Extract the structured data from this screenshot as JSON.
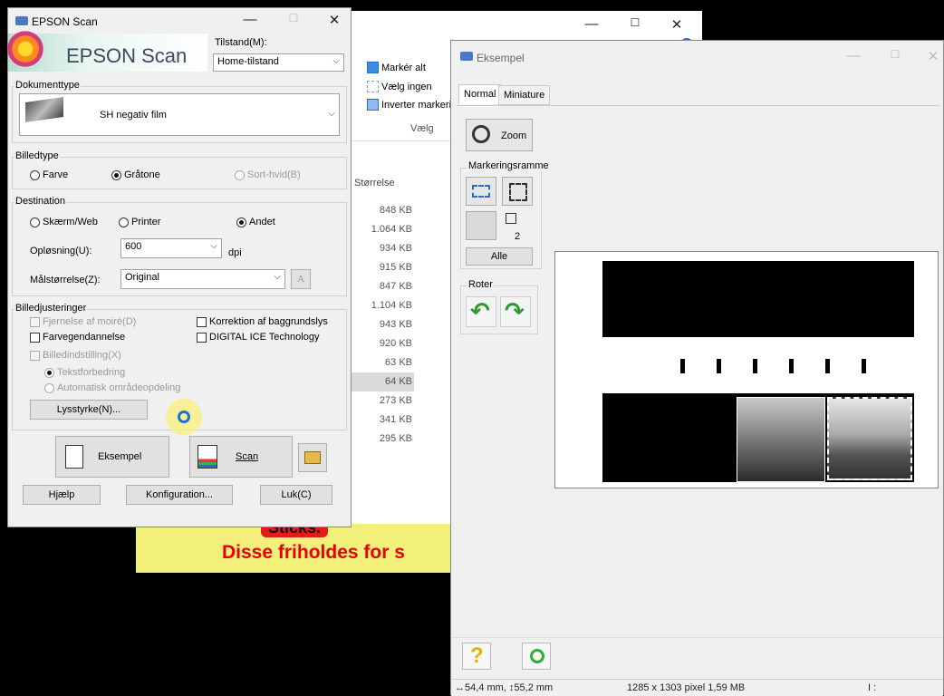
{
  "epson": {
    "title": "EPSON Scan",
    "logo_text": "EPSON Scan",
    "mode_label": "Tilstand(M):",
    "mode_value": "Home-tilstand",
    "doctype_group": "Dokumenttype",
    "doctype_value": "SH negativ film",
    "imagetype_group": "Billedtype",
    "imagetype_options": [
      "Farve",
      "Gråtone",
      "Sort-hvid(B)"
    ],
    "destination_group": "Destination",
    "destination_options": [
      "Skærm/Web",
      "Printer",
      "Andet"
    ],
    "resolution_label": "Opløsning(U):",
    "resolution_value": "600",
    "resolution_unit": "dpi",
    "target_size_label": "Målstørrelse(Z):",
    "target_size_value": "Original",
    "adjust_group": "Billedjusteringer",
    "adjust_options": {
      "moire": "Fjernelse af moiré(D)",
      "background": "Korrektion af baggrundslys",
      "color_restore": "Farvegendannelse",
      "ice": "DIGITAL ICE Technology",
      "image_option": "Billedindstilling(X)",
      "text_enhance": "Tekstforbedring",
      "auto_area": "Automatisk områdeopdeling"
    },
    "brightness_button": "Lysstyrke(N)...",
    "preview_button": "Eksempel",
    "scan_button": "Scan",
    "help_button": "Hjælp",
    "config_button": "Konfiguration...",
    "close_button": "Luk(C)"
  },
  "explorer": {
    "select_all": "Markér alt",
    "select_none": "Vælg ingen",
    "invert": "Inverter markeri",
    "group_label": "Vælg",
    "size_header": "Størrelse",
    "sizes": [
      "848 KB",
      "1.064 KB",
      "934 KB",
      "915 KB",
      "847 KB",
      "1.104 KB",
      "943 KB",
      "920 KB",
      "63 KB",
      "64 KB",
      "273 KB",
      "341 KB",
      "295 KB"
    ]
  },
  "preview": {
    "title": "Eksempel",
    "tabs": [
      "Normal",
      "Miniature"
    ],
    "zoom_label": "Zoom",
    "frame_group": "Markeringsramme",
    "frame_count": "2",
    "all_button": "Alle",
    "rotate_group": "Roter",
    "status_size": "54,4 mm",
    "status_height": "55,2 mm",
    "status_pixels": "1285 x 1303 pixel 1,59 MB",
    "status_extra": "I :"
  },
  "banner": {
    "line1": "Sticks.",
    "line2": "Disse friholdes for s"
  },
  "colors": {
    "banner_bg": "#f2f07a",
    "banner_text": "#e60000",
    "accent_blue": "#1e6fd9",
    "arrow_green": "#2e9a2e"
  }
}
